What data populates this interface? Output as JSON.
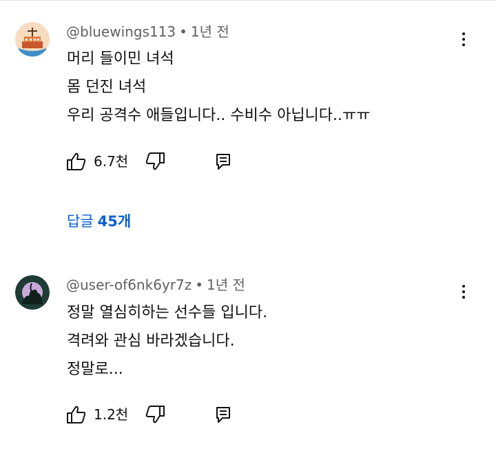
{
  "comments": [
    {
      "username": "@bluewings113",
      "separator": "•",
      "time": "1년 전",
      "lines": [
        "머리 들이민 녀석",
        "몸 던진 녀석",
        "우리 공격수 애들입니다.. 수비수 아닙니다..ㅠㅠ"
      ],
      "likes": "6.7천",
      "replies_label": "답글",
      "replies_count": "45개"
    },
    {
      "username": "@user-of6nk6yr7z",
      "separator": "•",
      "time": "1년 전",
      "lines": [
        "정말 열심히하는 선수들 입니다.",
        "격려와 관심 바라겠습니다.",
        "정말로..."
      ],
      "likes": "1.2천"
    }
  ],
  "icons": {
    "like": "thumbs-up-icon",
    "dislike": "thumbs-down-icon",
    "reply": "reply-icon",
    "menu": "more-vert-icon"
  },
  "colors": {
    "link": "#065fd4",
    "meta": "#606060",
    "text": "#0f0f0f"
  }
}
